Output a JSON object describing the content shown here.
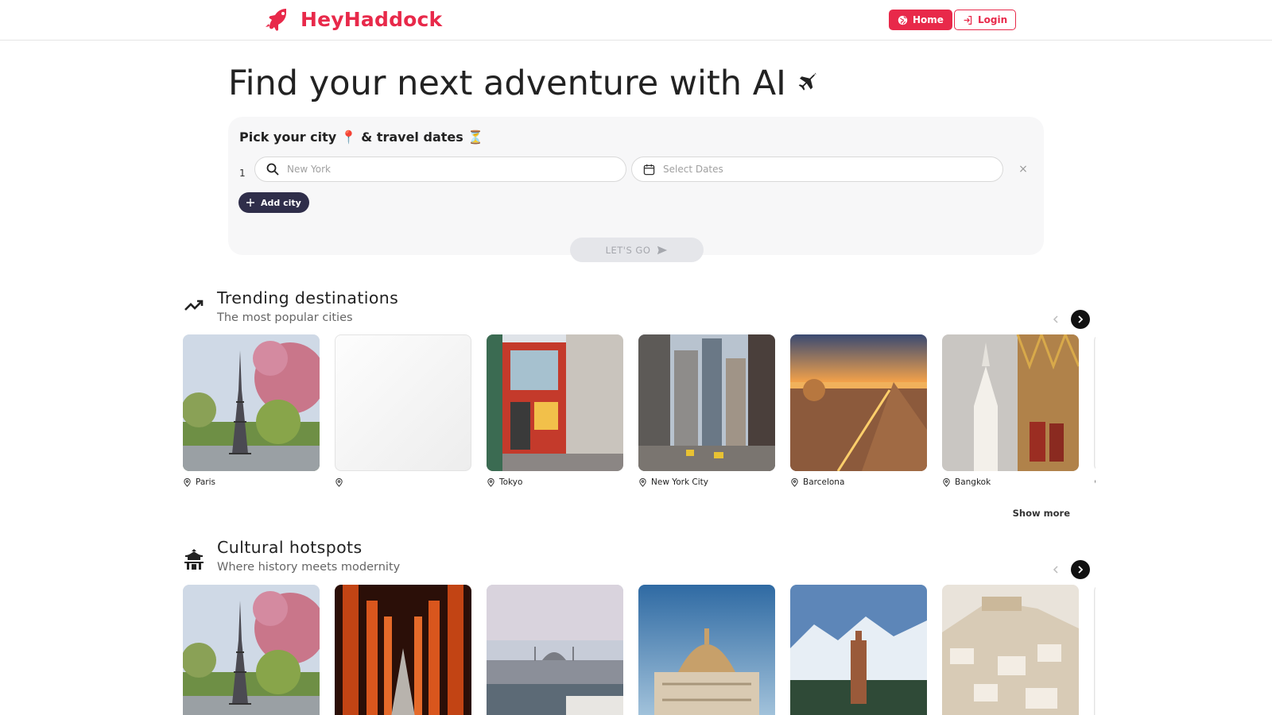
{
  "header": {
    "brand_name": "HeyHaddock",
    "nav": {
      "home_label": "Home",
      "login_label": "Login"
    }
  },
  "hero": {
    "title": "Find your next adventure with AI"
  },
  "form": {
    "title": "Pick your city 📍 & travel dates ⏳",
    "row_index": "1",
    "city_placeholder": "New York",
    "dates_placeholder": "Select Dates",
    "clear_label": "×",
    "add_city_label": "Add city",
    "submit_label": "LET'S GO"
  },
  "sections": {
    "trending": {
      "title": "Trending destinations",
      "subtitle": "The most popular cities",
      "show_more_label": "Show more",
      "cards": [
        {
          "city": "Paris",
          "theme": "eiffel"
        },
        {
          "city": "",
          "theme": "blank"
        },
        {
          "city": "Tokyo",
          "theme": "street-red"
        },
        {
          "city": "New York City",
          "theme": "skyscrapers"
        },
        {
          "city": "Barcelona",
          "theme": "city-sunset"
        },
        {
          "city": "Bangkok",
          "theme": "temple"
        },
        {
          "city": "",
          "theme": "partial"
        }
      ]
    },
    "cultural": {
      "title": "Cultural hotspots",
      "subtitle": "Where history meets modernity",
      "cards": [
        {
          "city": "",
          "theme": "eiffel"
        },
        {
          "city": "",
          "theme": "torii"
        },
        {
          "city": "",
          "theme": "bosphorus"
        },
        {
          "city": "",
          "theme": "palace-dome"
        },
        {
          "city": "",
          "theme": "minaret-mountains"
        },
        {
          "city": "",
          "theme": "hill-town"
        },
        {
          "city": "",
          "theme": "partial"
        }
      ]
    }
  },
  "colors": {
    "brand": "#e8294a",
    "dark_button": "#2f2e4a",
    "card_bg": "#f7f7f8"
  }
}
